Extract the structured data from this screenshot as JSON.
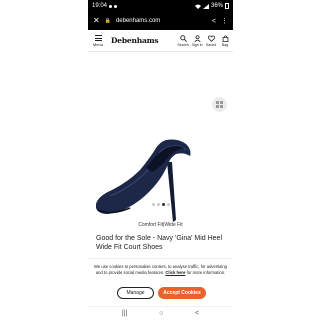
{
  "status_bar": {
    "time": "19:04",
    "battery": "36%"
  },
  "browser": {
    "url": "debenhams.com",
    "close_icon": "close-icon",
    "lock_icon": "lock-icon",
    "share_icon": "share-icon",
    "menu_icon": "kebab-icon"
  },
  "header": {
    "menu_label": "Menu",
    "logo": "Debenhams",
    "icons": [
      {
        "name": "search-icon",
        "label": "Search"
      },
      {
        "name": "account-icon",
        "label": "Sign in"
      },
      {
        "name": "heart-icon",
        "label": "Saved"
      },
      {
        "name": "bag-icon",
        "label": "Bag"
      }
    ]
  },
  "product": {
    "image_alt": "Navy court shoe",
    "carousel_count": 4,
    "carousel_active": 2,
    "fit_label": "Comfort Fit|Wide Fit",
    "title": "Good for the Sole - Navy 'Gina' Mid Heel Wide Fit Court Shoes"
  },
  "cookie_banner": {
    "message": "We use cookies to personalise content, to analyse traffic, for advertising and to provide social media features.",
    "link_text": "Click here",
    "message_tail": "for more information.",
    "manage_label": "Manage",
    "accept_label": "Accept Cookies",
    "accept_color": "#e8632b"
  },
  "nav_bar": {
    "recent_icon": "recent-apps-icon",
    "home_icon": "home-icon",
    "back_icon": "back-icon"
  }
}
